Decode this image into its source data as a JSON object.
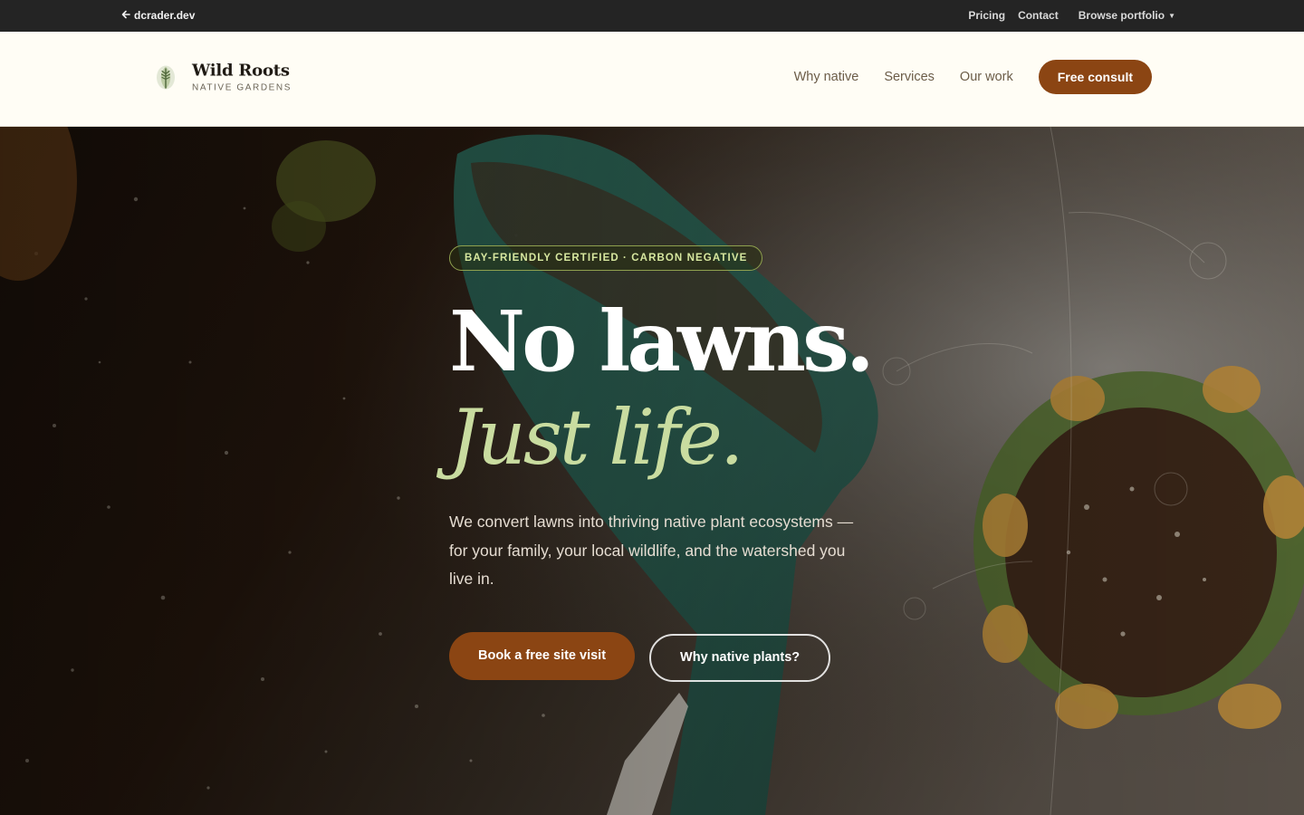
{
  "topbar": {
    "back_label": "dcrader.dev",
    "pricing": "Pricing",
    "contact": "Contact",
    "browse": "Browse portfolio"
  },
  "header": {
    "brand_name": "Wild Roots",
    "brand_tagline": "NATIVE GARDENS",
    "nav": [
      "Why native",
      "Services",
      "Our work"
    ],
    "cta": "Free consult"
  },
  "hero": {
    "badge": "BAY-FRIENDLY CERTIFIED · CARBON NEGATIVE",
    "headline": "No lawns.",
    "headline_italic": "Just life.",
    "lead": "We convert lawns into thriving native plant ecosystems — for your family, your local wildlife, and the watershed you live in.",
    "primary_button": "Book a free site visit",
    "secondary_button": "Why native plants?"
  },
  "colors": {
    "accent": "#8b4513",
    "sage": "#c9dca0",
    "topbar": "#242424",
    "header_bg": "#fffdf5"
  },
  "icons": [
    "arrow-left-icon",
    "chevron-down-icon",
    "leaf-logo-icon"
  ]
}
